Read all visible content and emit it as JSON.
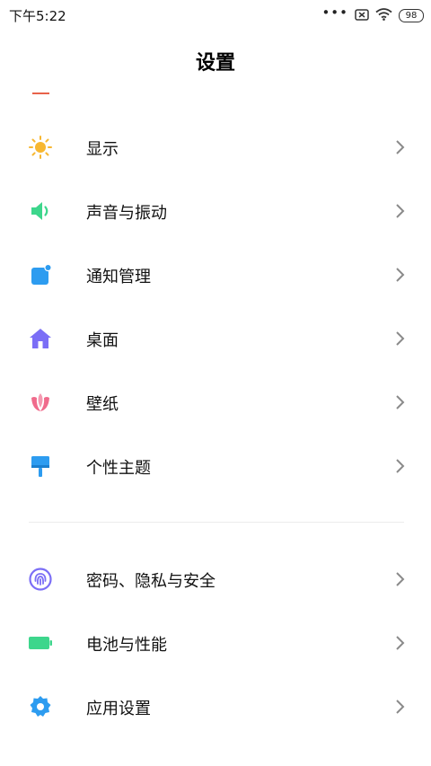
{
  "status_bar": {
    "time": "下午5:22",
    "dots": "•••",
    "battery": "98"
  },
  "header": {
    "title": "设置"
  },
  "groups": [
    {
      "items": [
        {
          "label": "显示",
          "icon": "sun-icon",
          "color": "#f7b731"
        },
        {
          "label": "声音与振动",
          "icon": "speaker-icon",
          "color": "#3dd68c"
        },
        {
          "label": "通知管理",
          "icon": "notification-icon",
          "color": "#2d9cf0"
        },
        {
          "label": "桌面",
          "icon": "home-icon",
          "color": "#7b6ef6"
        },
        {
          "label": "壁纸",
          "icon": "tulip-icon",
          "color": "#f06b8c"
        },
        {
          "label": "个性主题",
          "icon": "paint-brush-icon",
          "color": "#2d9cf0"
        }
      ]
    },
    {
      "items": [
        {
          "label": "密码、隐私与安全",
          "icon": "fingerprint-icon",
          "color": "#7b6ef6"
        },
        {
          "label": "电池与性能",
          "icon": "battery-icon",
          "color": "#3dd68c"
        },
        {
          "label": "应用设置",
          "icon": "gear-icon",
          "color": "#2d9cf0"
        }
      ]
    }
  ],
  "colors": {
    "accent_line": "#e8624a",
    "chevron": "#8a8a8a"
  }
}
